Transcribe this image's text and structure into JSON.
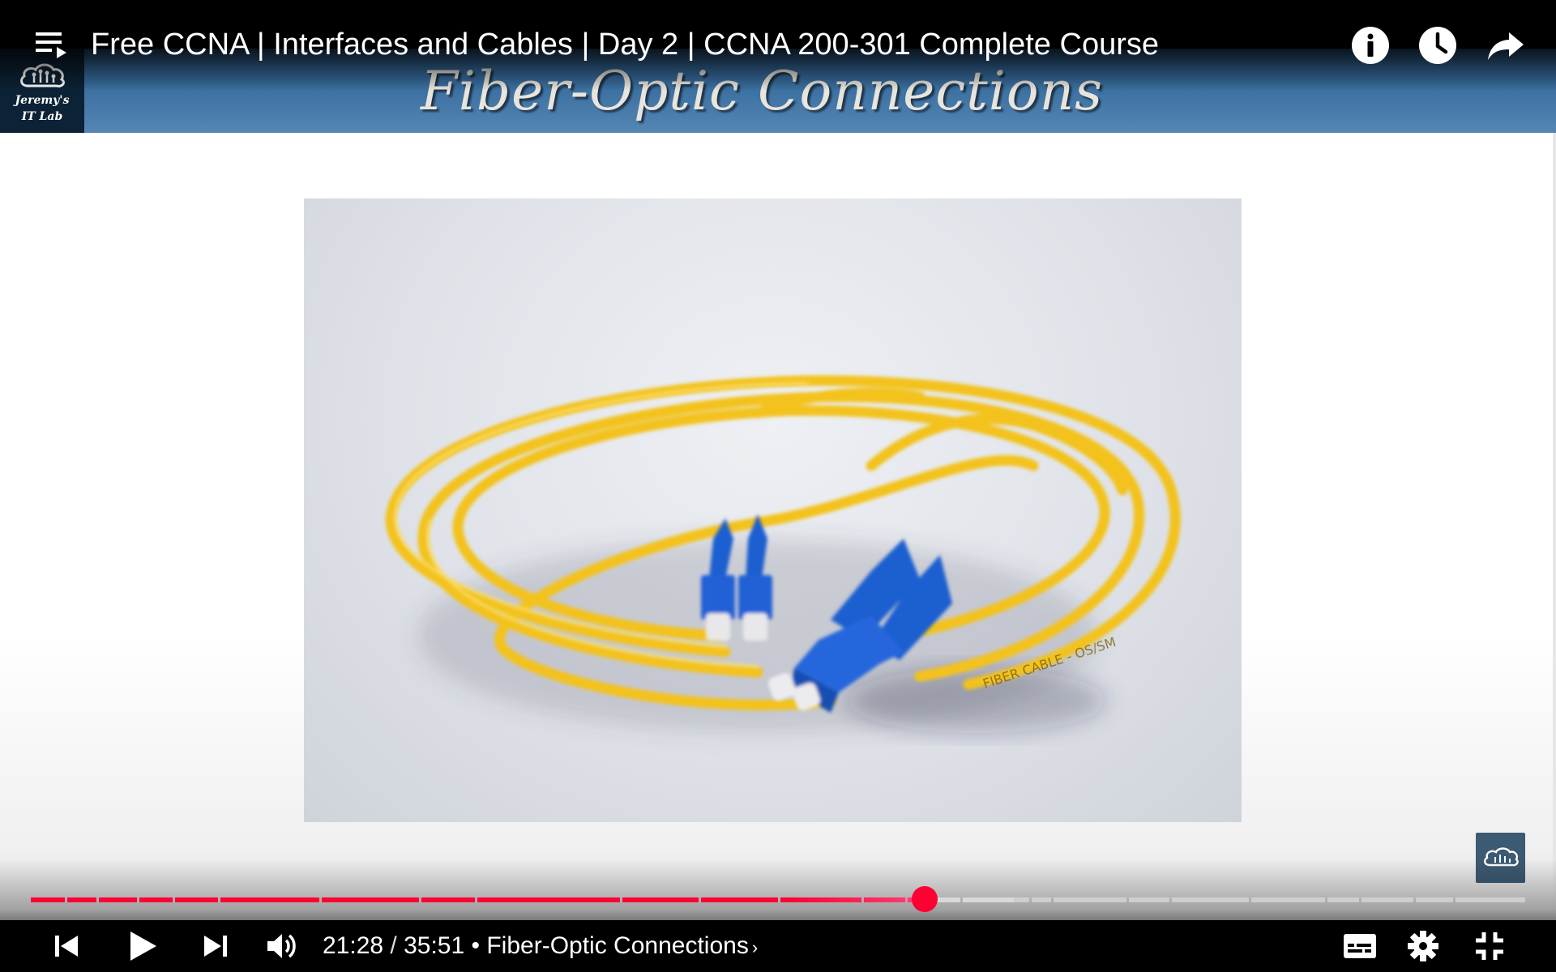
{
  "video": {
    "title": "Free CCNA | Interfaces and Cables | Day 2 | CCNA 200-301 Complete Course"
  },
  "slide": {
    "heading": "Fiber-Optic Connections",
    "channel_logo_line1": "Jeremy's",
    "channel_logo_line2": "IT Lab",
    "photo_cable_print": "FIBER CABLE - OS/SM"
  },
  "player": {
    "current_time": "21:28",
    "separator": " / ",
    "duration": "35:51",
    "chapter_prefix": "• ",
    "chapter_title": "Fiber-Optic Connections",
    "chapter_chevron": "›",
    "progress_fraction": 0.598,
    "accent_color": "#ff0033",
    "icons": {
      "top": [
        "playlist-icon",
        "info-icon",
        "clock-icon",
        "share-icon"
      ],
      "bottom": [
        "previous-icon",
        "play-icon",
        "next-icon",
        "volume-icon",
        "captions-icon",
        "settings-icon",
        "exit-fullscreen-icon"
      ]
    }
  },
  "colors": {
    "banner_blue": "#3a6fa0",
    "cable_yellow": "#f3c21a",
    "connector_blue": "#1f5fd0",
    "played": "#ff0033",
    "buffered": "#d9d9d9",
    "unplayed": "#e8e8e8"
  }
}
